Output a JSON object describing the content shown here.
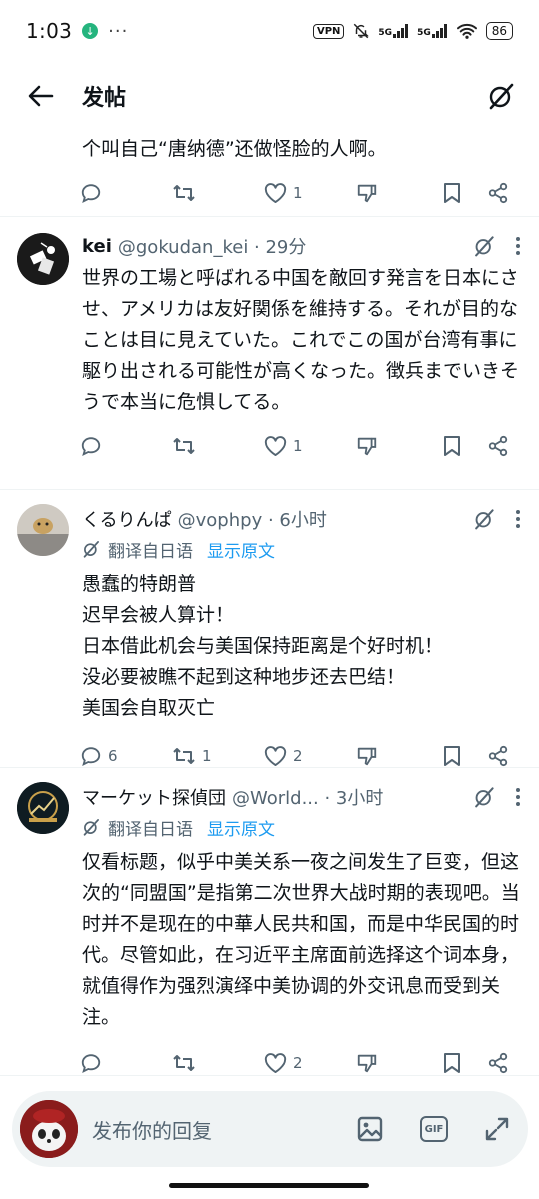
{
  "status_bar": {
    "time": "1:03",
    "more": "···",
    "vpn": "VPN",
    "net1": "5G",
    "net2": "5G",
    "battery": "86"
  },
  "header": {
    "title": "发帖"
  },
  "posts": [
    {
      "text": "个叫自己“唐纳德”还做怪脸的人啊。",
      "reply_count": "",
      "retweet_count": "",
      "like_count": "1"
    },
    {
      "name": "kei",
      "handle": "@gokudan_kei · 29分",
      "text": "世界の工場と呼ばれる中国を敵回す発言を日本にさせ、アメリカは友好関係を維持する。それが目的なことは目に見えていた。これでこの国が台湾有事に駆り出される可能性が高くなった。徴兵までいきそうで本当に危惧してる。",
      "reply_count": "",
      "retweet_count": "",
      "like_count": "1"
    },
    {
      "name": "くるりんぱ",
      "handle": "@vophpy · 6小时",
      "translate_label": "翻译自日语",
      "show_original": "显示原文",
      "lines": [
        "愚蠢的特朗普",
        "迟早会被人算计！",
        "日本借此机会与美国保持距离是个好时机！",
        "没必要被瞧不起到这种地步还去巴结！",
        "美国会自取灭亡"
      ],
      "reply_count": "6",
      "retweet_count": "1",
      "like_count": "2"
    },
    {
      "name": "マーケット探偵団",
      "handle": "@World... · 3小时",
      "translate_label": "翻译自日语",
      "show_original": "显示原文",
      "text": "仅看标题，似乎中美关系一夜之间发生了巨变，但这次的“同盟国”是指第二次世界大战时期的表现吧。当时并不是现在的中華人民共和国，而是中华民国的时代。尽管如此，在习近平主席面前选择这个词本身，就值得作为强烈演绎中美协调的外交讯息而受到关注。",
      "reply_count": "",
      "retweet_count": "",
      "like_count": "2"
    }
  ],
  "reply_bar": {
    "placeholder": "发布你的回复",
    "gif_label": "GIF"
  }
}
